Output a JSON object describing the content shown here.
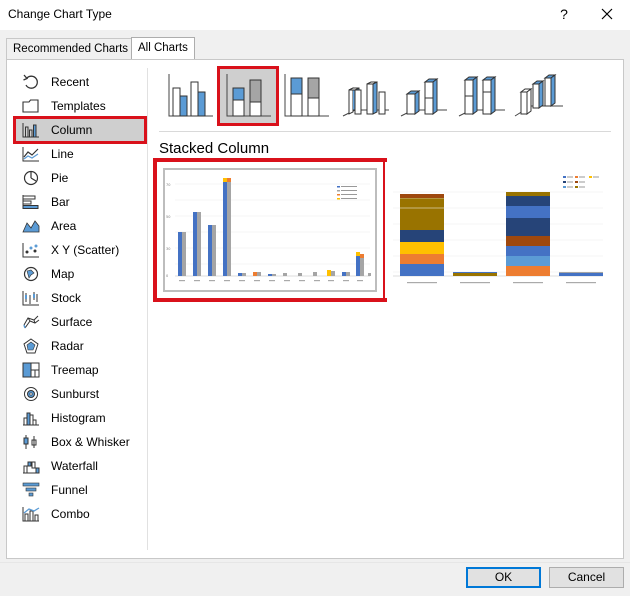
{
  "window": {
    "title": "Change Chart Type",
    "help_glyph": "?"
  },
  "tabs": [
    {
      "label": "Recommended Charts"
    },
    {
      "label": "All Charts"
    }
  ],
  "sidebar": {
    "items": [
      {
        "label": "Recent",
        "icon": "recent-icon"
      },
      {
        "label": "Templates",
        "icon": "folder-icon"
      },
      {
        "label": "Column",
        "icon": "column-chart-icon",
        "selected": true
      },
      {
        "label": "Line",
        "icon": "line-chart-icon"
      },
      {
        "label": "Pie",
        "icon": "pie-chart-icon"
      },
      {
        "label": "Bar",
        "icon": "bar-chart-icon"
      },
      {
        "label": "Area",
        "icon": "area-chart-icon"
      },
      {
        "label": "X Y (Scatter)",
        "icon": "scatter-chart-icon"
      },
      {
        "label": "Map",
        "icon": "map-chart-icon"
      },
      {
        "label": "Stock",
        "icon": "stock-chart-icon"
      },
      {
        "label": "Surface",
        "icon": "surface-chart-icon"
      },
      {
        "label": "Radar",
        "icon": "radar-chart-icon"
      },
      {
        "label": "Treemap",
        "icon": "treemap-chart-icon"
      },
      {
        "label": "Sunburst",
        "icon": "sunburst-chart-icon"
      },
      {
        "label": "Histogram",
        "icon": "histogram-chart-icon"
      },
      {
        "label": "Box & Whisker",
        "icon": "box-whisker-chart-icon"
      },
      {
        "label": "Waterfall",
        "icon": "waterfall-chart-icon"
      },
      {
        "label": "Funnel",
        "icon": "funnel-chart-icon"
      },
      {
        "label": "Combo",
        "icon": "combo-chart-icon"
      }
    ]
  },
  "subtypes": [
    {
      "icon": "clustered-column-icon"
    },
    {
      "icon": "stacked-column-icon",
      "selected": true
    },
    {
      "icon": "100-percent-stacked-column-icon"
    },
    {
      "icon": "3d-clustered-column-icon"
    },
    {
      "icon": "3d-stacked-column-icon"
    },
    {
      "icon": "3d-100-percent-stacked-column-icon"
    },
    {
      "icon": "3d-column-icon"
    }
  ],
  "variant_title": "Stacked Column",
  "footer": {
    "ok_label": "OK",
    "cancel_label": "Cancel"
  },
  "colors": {
    "accent_red": "#d9111b",
    "series_blue": "#4472c4",
    "series_gray": "#a5a5a5",
    "series_orange": "#ed7d31",
    "series_gold": "#ffc000",
    "series_olive": "#997300",
    "series_navy": "#264478",
    "icon_blue": "#5b9bd5",
    "ok_border": "#0078d7"
  }
}
